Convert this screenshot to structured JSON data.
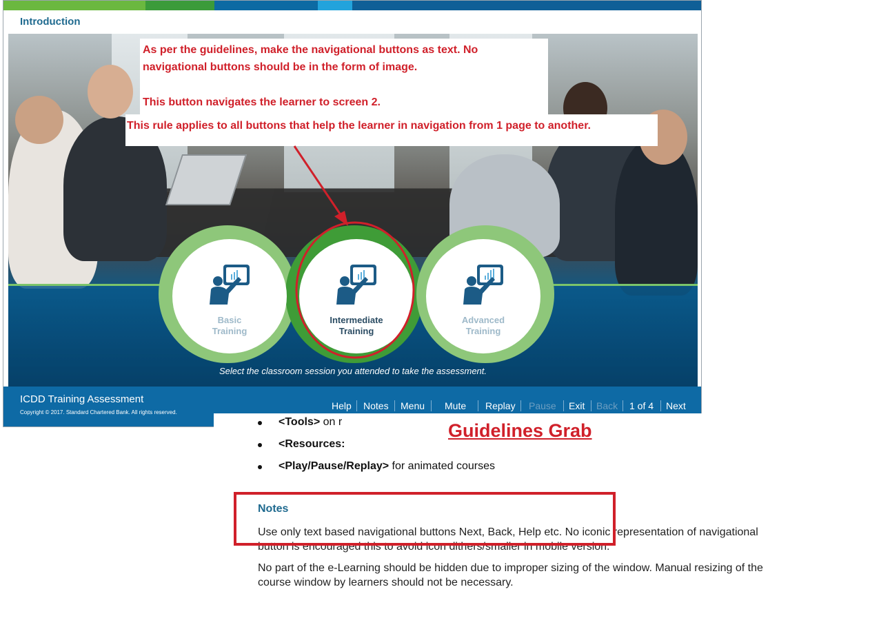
{
  "course": {
    "header_title": "Introduction",
    "accent_colors": [
      "#6bb83f",
      "#3b9b3a",
      "#0d6aa3",
      "#22a3dc",
      "#0f5f97"
    ],
    "buttons": [
      {
        "line1": "Basic",
        "line2": "Training",
        "state": "inactive"
      },
      {
        "line1": "Intermediate",
        "line2": "Training",
        "state": "selected"
      },
      {
        "line1": "Advanced",
        "line2": "Training",
        "state": "inactive"
      }
    ],
    "prompt": "Select the classroom session you attended to take the assessment.",
    "footer": {
      "title": "ICDD Training Assessment",
      "copyright": "Copyright © 2017. Standard Chartered Bank. All rights reserved.",
      "nav": {
        "help": "Help",
        "notes": "Notes",
        "menu": "Menu",
        "mute": "Mute",
        "replay": "Replay",
        "pause": "Pause",
        "exit": "Exit",
        "back": "Back",
        "page": "1 of 4",
        "next": "Next"
      }
    }
  },
  "annotation": {
    "line1": "As per the guidelines, make the navigational buttons as text. No",
    "line2": "navigational buttons should be in the form of image.",
    "line3": "This button navigates the learner to screen 2.",
    "line4": "This rule applies to all buttons that help the learner in navigation from 1 page to another."
  },
  "guidelines": {
    "title": "Guidelines Grab",
    "bullets": [
      {
        "bold": "<Tools>",
        "rest": " on r"
      },
      {
        "bold": "<Resources:",
        "rest": ""
      },
      {
        "bold": "<Play/Pause/Replay>",
        "rest": " for animated courses"
      }
    ],
    "notes_heading": "Notes",
    "para1": "Use only text based navigational buttons Next, Back, Help etc. No iconic representation of navigational button is encouraged this to avoid icon dithers/smaller in mobile version.",
    "para2": "No part of the e-Learning should be hidden due to improper sizing of the window. Manual resizing of the course window by learners should not be necessary."
  }
}
